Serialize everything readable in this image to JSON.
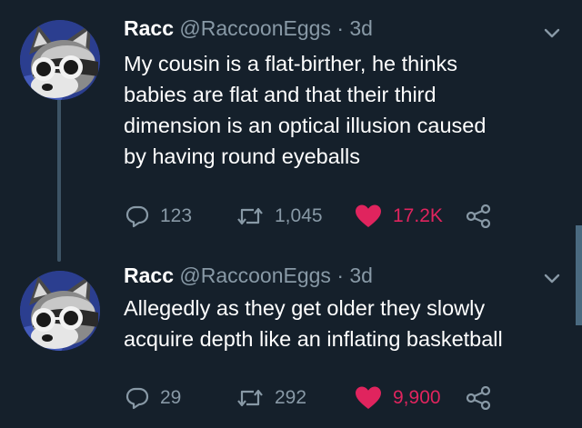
{
  "colors": {
    "background": "#15202b",
    "secondary_text": "#8899a6",
    "like_red": "#e0245e",
    "thread_line": "#3d5466"
  },
  "tweets": [
    {
      "name": "Racc",
      "handle": "@RaccoonEggs",
      "separator": "·",
      "time": "3d",
      "text_lines": [
        "My cousin is a flat-birther, he thinks",
        "babies are flat and that their third",
        "dimension is an optical illusion caused",
        "by having round eyeballs"
      ],
      "replies": "123",
      "retweets": "1,045",
      "likes": "17.2K",
      "liked": true
    },
    {
      "name": "Racc",
      "handle": "@RaccoonEggs",
      "separator": "·",
      "time": "3d",
      "text_lines": [
        "Allegedly as they get older they slowly",
        "acquire depth like an inflating basketball"
      ],
      "replies": "29",
      "retweets": "292",
      "likes": "9,900",
      "liked": true
    }
  ],
  "icons": {
    "reply": "reply-bubble-icon",
    "retweet": "retweet-icon",
    "like": "heart-icon",
    "share": "share-icon",
    "menu": "chevron-down-icon"
  }
}
